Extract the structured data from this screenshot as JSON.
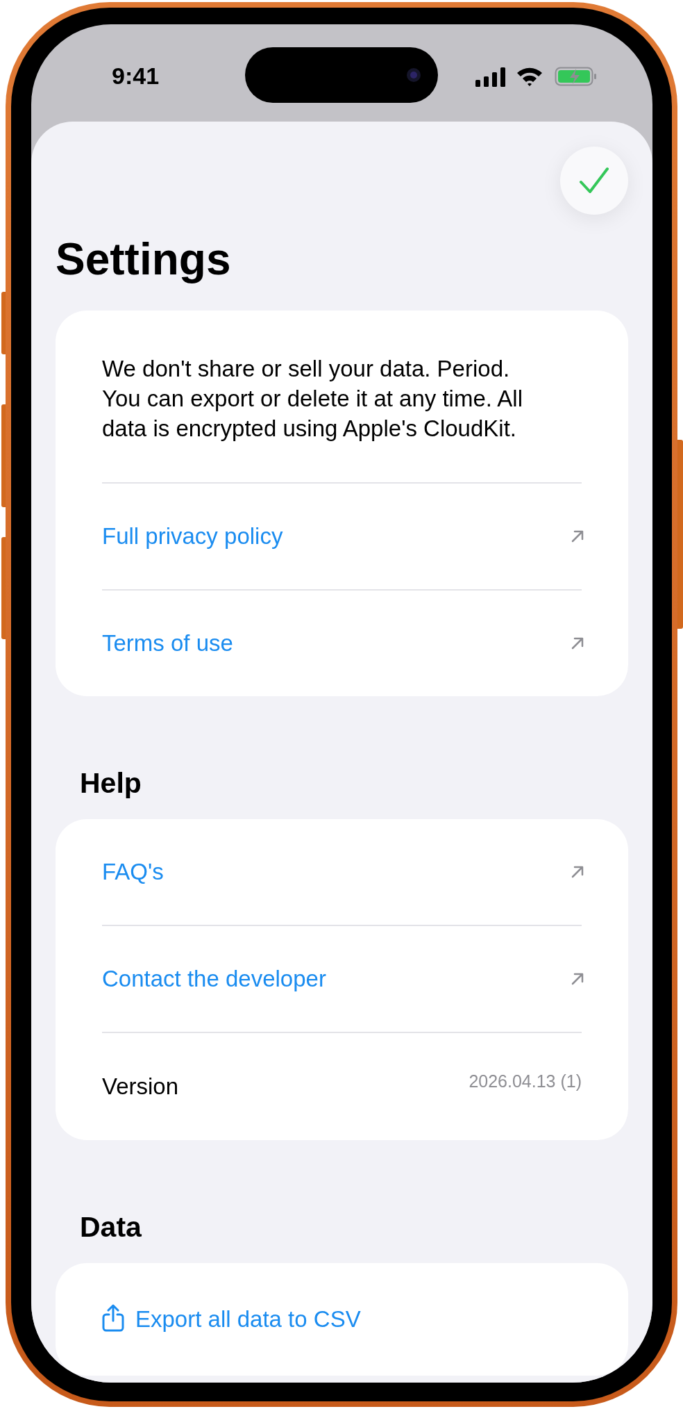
{
  "status_bar": {
    "time": "9:41"
  },
  "title": "Settings",
  "privacy": {
    "text": "We don't share or sell your data. Period. You can export or delete it at any time. All data is encrypted using Apple's CloudKit.",
    "links": [
      {
        "label": "Full privacy policy"
      },
      {
        "label": "Terms of use"
      }
    ]
  },
  "sections": [
    {
      "title": "Help",
      "rows": [
        {
          "kind": "link",
          "label": "FAQ's"
        },
        {
          "kind": "link",
          "label": "Contact the developer"
        },
        {
          "kind": "value",
          "label": "Version",
          "value": "2026.04.13 (1)"
        }
      ]
    },
    {
      "title": "Data",
      "rows": [
        {
          "kind": "action",
          "label": "Export all data to CSV"
        }
      ]
    }
  ]
}
